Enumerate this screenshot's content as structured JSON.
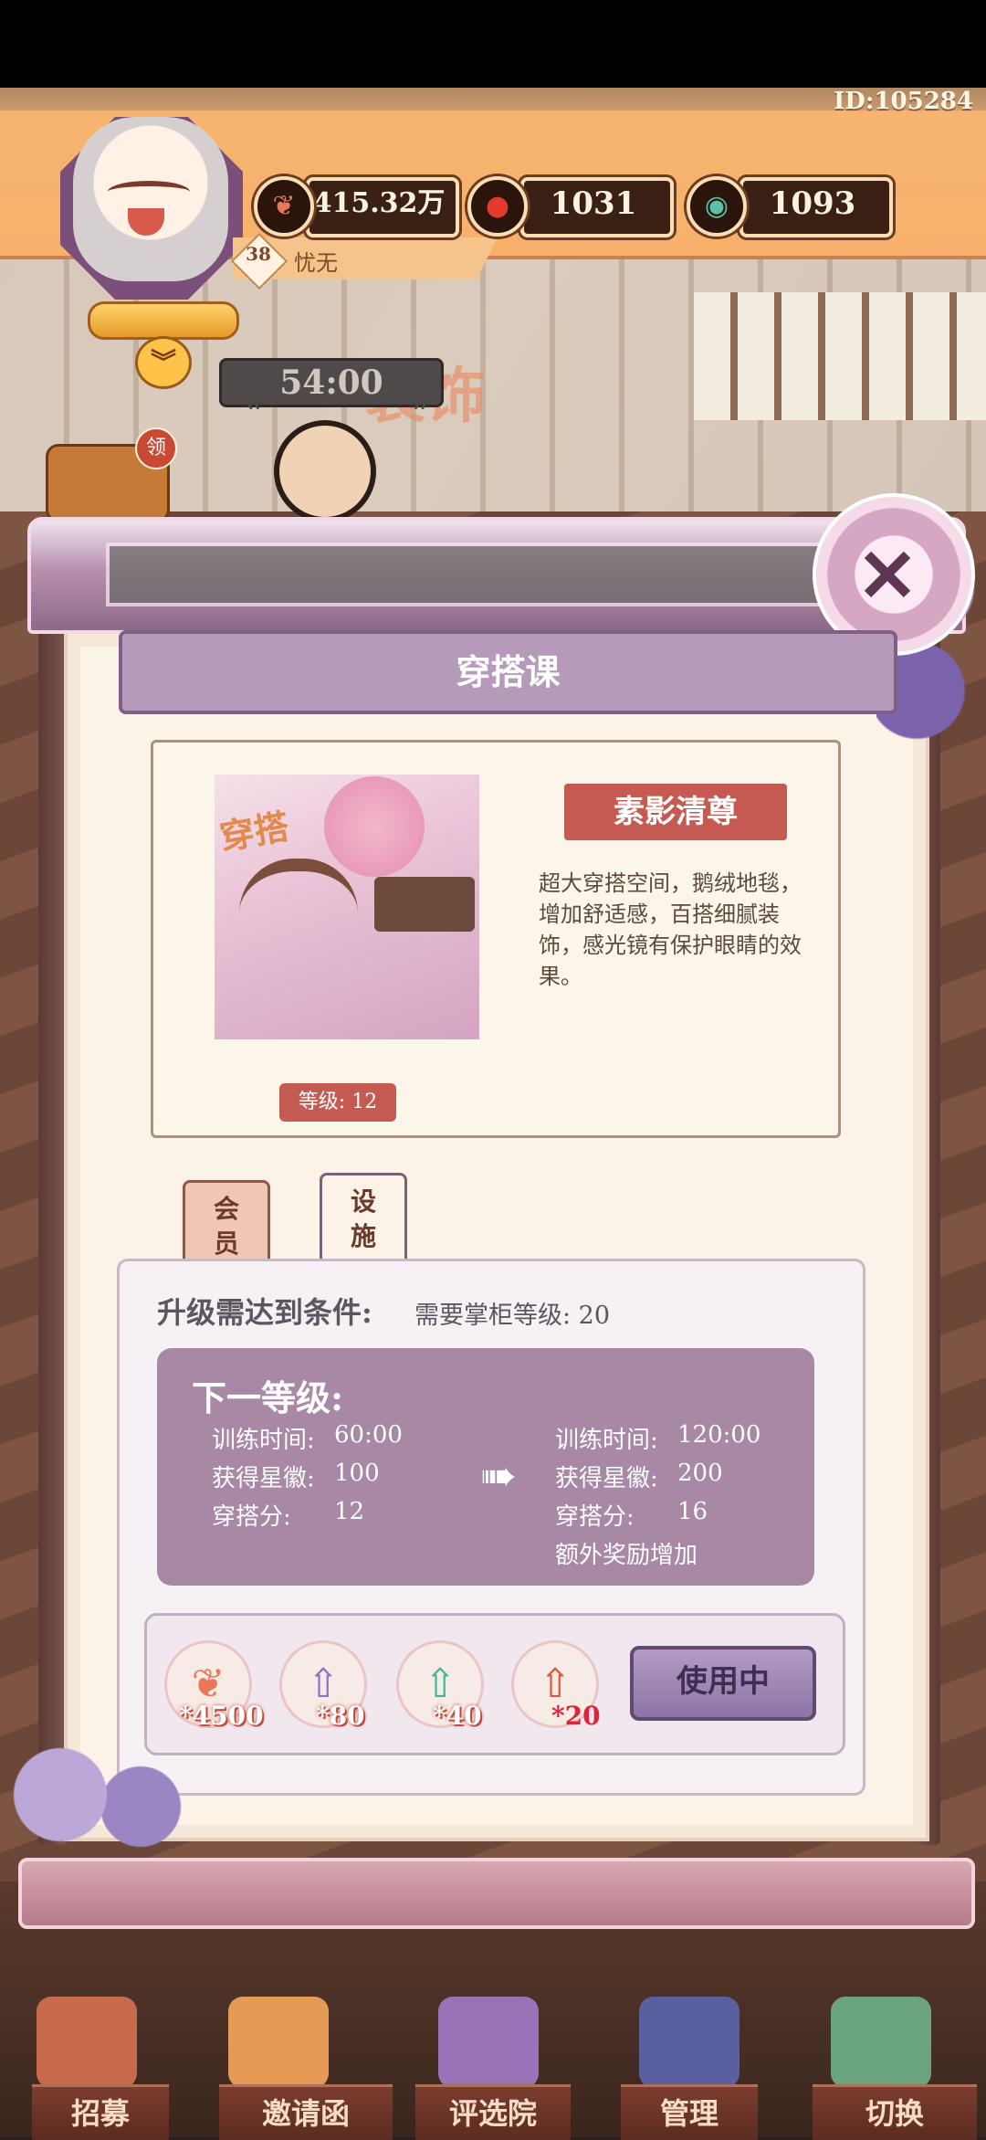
{
  "player": {
    "id_text": "ID:105284",
    "level": "38",
    "name": "忧无"
  },
  "resources": [
    {
      "icon": "peach-heart-icon",
      "value": "415.32万"
    },
    {
      "icon": "red-orb-icon",
      "value": "1031"
    },
    {
      "icon": "jade-coin-icon",
      "value": "1093"
    }
  ],
  "timer": "54:00",
  "claim_badge": "领",
  "scene_text": "装饰",
  "modal": {
    "title": "穿搭课",
    "item": {
      "name": "素影清尊",
      "description": "超大穿搭空间，鹅绒地毯，增加舒适感，百搭细腻装饰，感光镜有保护眼睛的效果。",
      "level_label": "等级: 12",
      "preview_stamp": "穿搭"
    },
    "tabs": [
      {
        "label_line1": "会",
        "label_line2": "员"
      },
      {
        "label_line1": "设",
        "label_line2": "施"
      }
    ],
    "requirement": {
      "label": "升级需达到条件:",
      "value": "需要掌柜等级: 20"
    },
    "next_level": {
      "title": "下一等级:",
      "current": [
        {
          "label": "训练时间:",
          "value": "60:00"
        },
        {
          "label": "获得星徽:",
          "value": "100"
        },
        {
          "label": "穿搭分:",
          "value": "12"
        }
      ],
      "next": [
        {
          "label": "训练时间:",
          "value": "120:00"
        },
        {
          "label": "获得星徽:",
          "value": "200"
        },
        {
          "label": "穿搭分:",
          "value": "16"
        }
      ],
      "extra": "额外奖励增加"
    },
    "costs": [
      {
        "icon": "peach-heart-icon",
        "qty": "*4500"
      },
      {
        "icon": "purple-up-arrow-icon",
        "qty": "*80"
      },
      {
        "icon": "green-up-arrow-icon",
        "qty": "*40"
      },
      {
        "icon": "red-up-arrow-icon",
        "qty": "*20"
      }
    ],
    "action_button": "使用中"
  },
  "nav": [
    {
      "icon": "recruit-icon",
      "label": "招募"
    },
    {
      "icon": "invitation-icon",
      "label": "邀请函"
    },
    {
      "icon": "contest-hall-icon",
      "label": "评选院"
    },
    {
      "icon": "manage-icon",
      "label": "管理"
    },
    {
      "icon": "switch-map-icon",
      "label": "切换"
    }
  ],
  "colors": {
    "header_orange": "#f7b16b",
    "modal_purple": "#a888a5",
    "name_plate_red": "#c45a52",
    "nav_brown": "#6b3326"
  }
}
